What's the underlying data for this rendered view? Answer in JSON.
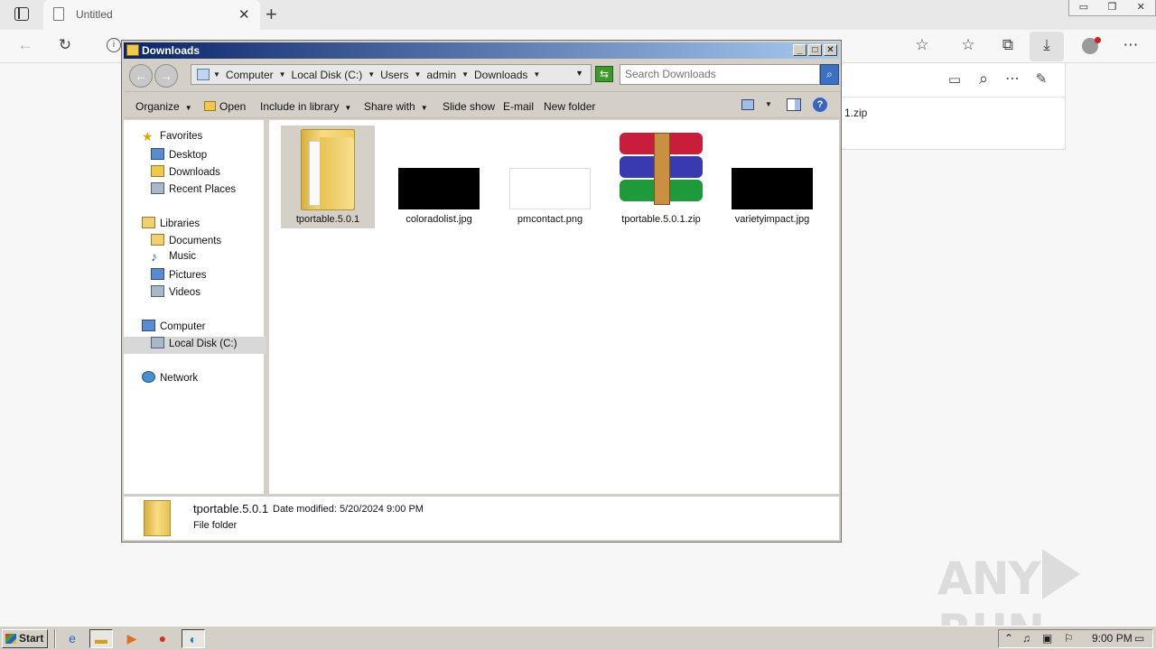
{
  "browser": {
    "tab_title": "Untitled",
    "tab_close": "✕",
    "new_tab": "+",
    "window_controls": [
      "▭",
      "❐",
      "✕"
    ],
    "toolbar_icons": {
      "back": "←",
      "refresh": "↻",
      "info": "i",
      "add_favorite": "☆",
      "favorites": "☆",
      "collections": "⧉",
      "downloads": "⤓",
      "more": "⋯"
    },
    "downloads_panel": {
      "file_text": "1.zip",
      "icons": {
        "open_folder": "▭",
        "search": "⌕",
        "more": "⋯",
        "pin": "✎"
      }
    }
  },
  "explorer": {
    "title": "Downloads",
    "title_buttons": [
      "_",
      "□",
      "✕"
    ],
    "breadcrumb": [
      "Computer",
      "Local Disk (C:)",
      "Users",
      "admin",
      "Downloads"
    ],
    "search_placeholder": "Search Downloads",
    "commands": {
      "organize": "Organize",
      "open": "Open",
      "include_in_library": "Include in library",
      "share_with": "Share with",
      "slide_show": "Slide show",
      "email": "E-mail",
      "new_folder": "New folder"
    },
    "nav": {
      "favorites": "Favorites",
      "desktop": "Desktop",
      "downloads": "Downloads",
      "recent_places": "Recent Places",
      "libraries": "Libraries",
      "documents": "Documents",
      "music": "Music",
      "pictures": "Pictures",
      "videos": "Videos",
      "computer": "Computer",
      "local_disk": "Local Disk (C:)",
      "network": "Network"
    },
    "files": [
      {
        "name": "tportable.5.0.1",
        "kind": "folder",
        "selected": true
      },
      {
        "name": "coloradolist.jpg",
        "kind": "black-image"
      },
      {
        "name": "pmcontact.png",
        "kind": "white-image"
      },
      {
        "name": "tportable.5.0.1.zip",
        "kind": "winrar-archive"
      },
      {
        "name": "varietyimpact.jpg",
        "kind": "black-image"
      }
    ],
    "details": {
      "name": "tportable.5.0.1",
      "modified": "Date modified: 5/20/2024 9:00 PM",
      "type": "File folder"
    }
  },
  "taskbar": {
    "start_label": "Start",
    "clock": "9:00 PM"
  },
  "watermark": {
    "left": "ANY",
    "right": "RUN"
  }
}
